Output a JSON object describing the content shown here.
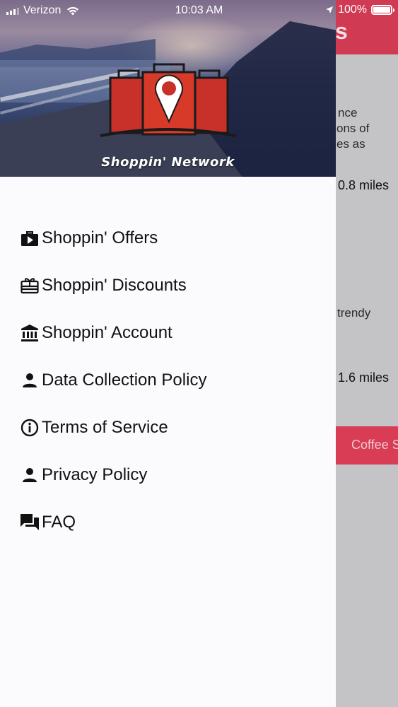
{
  "status_bar": {
    "carrier": "Verizon",
    "time": "10:03 AM",
    "battery": "100%"
  },
  "drawer": {
    "brand": "Shoppin' Network",
    "items": [
      {
        "label": "Shoppin' Offers",
        "icon": "briefcase-play-icon"
      },
      {
        "label": "Shoppin' Discounts",
        "icon": "gift-card-icon"
      },
      {
        "label": "Shoppin' Account",
        "icon": "bank-icon"
      },
      {
        "label": "Data Collection Policy",
        "icon": "person-icon"
      },
      {
        "label": "Terms of Service",
        "icon": "info-circle-icon"
      },
      {
        "label": "Privacy Policy",
        "icon": "person-icon"
      },
      {
        "label": "FAQ",
        "icon": "chat-bubbles-icon"
      }
    ]
  },
  "background": {
    "header_fragment": "s",
    "text_lines": [
      "nce",
      "ons of",
      "es as",
      "trendy"
    ],
    "distances": [
      "0.8 miles",
      "1.6 miles"
    ],
    "button_fragment": "Coffee S"
  },
  "colors": {
    "accent": "#d93d56",
    "drawer_bg": "#fbfbfd",
    "overlay": "#c4c4c6"
  }
}
